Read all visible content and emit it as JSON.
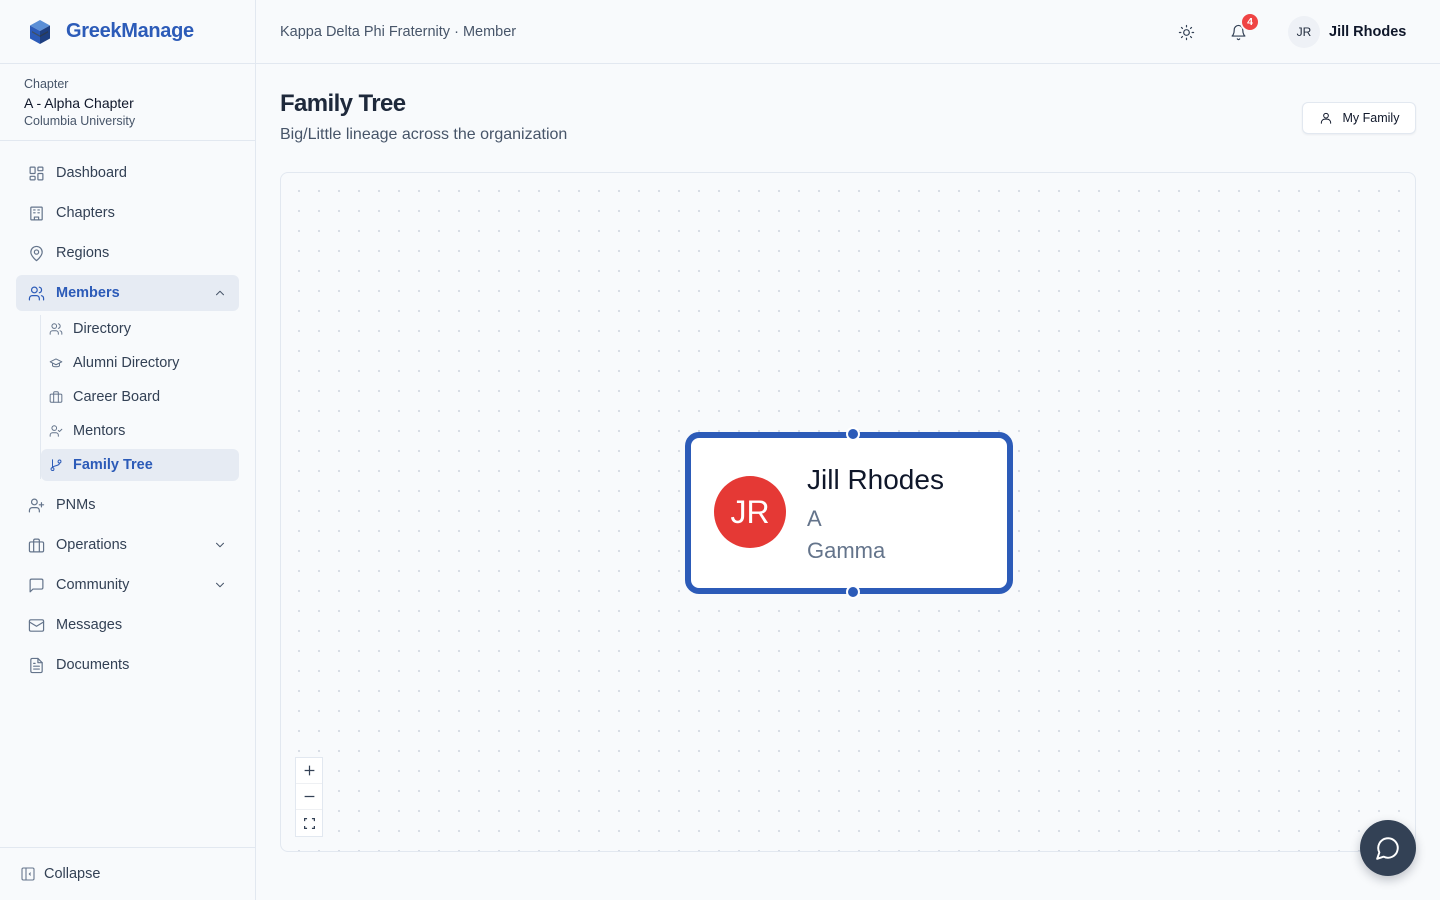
{
  "brand": {
    "name": "GreekManage"
  },
  "chapter": {
    "caption": "Chapter",
    "name": "A - Alpha Chapter",
    "school": "Columbia University"
  },
  "nav": {
    "dashboard": "Dashboard",
    "chapters": "Chapters",
    "regions": "Regions",
    "members": "Members",
    "members_sub": {
      "directory": "Directory",
      "alumni_directory": "Alumni Directory",
      "career_board": "Career Board",
      "mentors": "Mentors",
      "family_tree": "Family Tree"
    },
    "pnms": "PNMs",
    "operations": "Operations",
    "community": "Community",
    "messages": "Messages",
    "documents": "Documents",
    "collapse": "Collapse"
  },
  "header": {
    "breadcrumb": "Kappa Delta Phi Fraternity · Member",
    "notifications_count": "4",
    "user_initials": "JR",
    "user_name": "Jill Rhodes"
  },
  "page": {
    "title": "Family Tree",
    "subtitle": "Big/Little lineage across the organization",
    "my_family_label": "My Family"
  },
  "tree": {
    "node": {
      "initials": "JR",
      "name": "Jill Rhodes",
      "line1": "A",
      "line2": "Gamma",
      "avatar_color": "#e53935",
      "border_color": "#2c5bb8"
    }
  },
  "colors": {
    "accent": "#2c5bb8",
    "badge": "#ef4444",
    "fab": "#334155"
  }
}
